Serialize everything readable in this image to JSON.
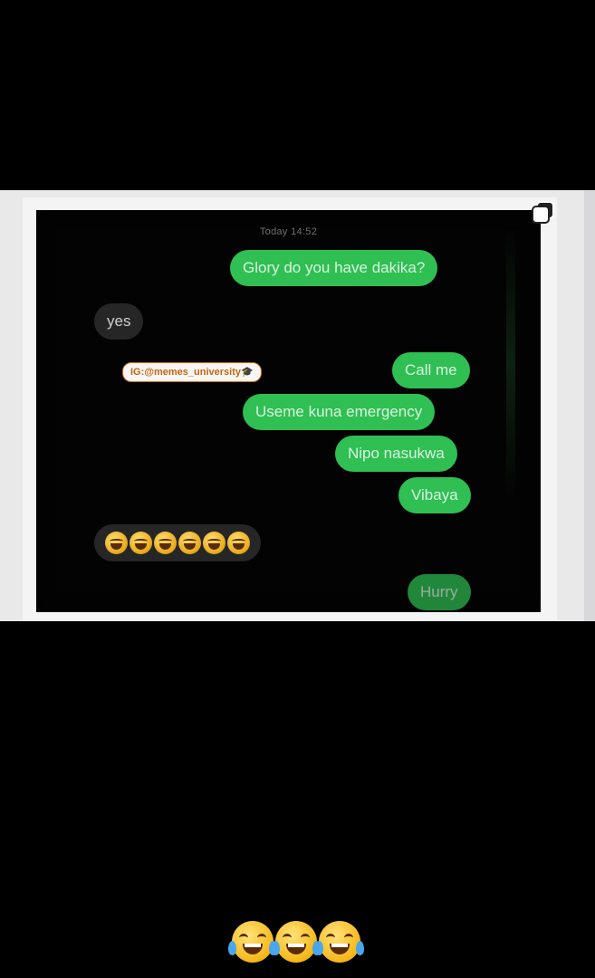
{
  "post": {
    "timestamp": "Today 14:52",
    "watermark": "IG:@memes_university🎓",
    "messages": [
      {
        "direction": "outgoing",
        "text": "Glory do you have dakika?"
      },
      {
        "direction": "incoming",
        "text": "yes"
      },
      {
        "direction": "outgoing",
        "text": "Call me"
      },
      {
        "direction": "outgoing",
        "text": "Useme kuna emergency"
      },
      {
        "direction": "outgoing",
        "text": "Nipo nasukwa"
      },
      {
        "direction": "outgoing",
        "text": "Vibaya"
      },
      {
        "direction": "incoming",
        "emoji": "face-with-tears-of-joy",
        "count": 6
      },
      {
        "direction": "outgoing",
        "text": "Hurry"
      }
    ]
  },
  "caption": {
    "emoji": "face-with-tears-of-joy",
    "count": 3
  },
  "icons": {
    "copy": "copy-icon"
  },
  "colors": {
    "outgoing": "#2fbf53",
    "incoming": "#262626",
    "background": "#000000"
  }
}
